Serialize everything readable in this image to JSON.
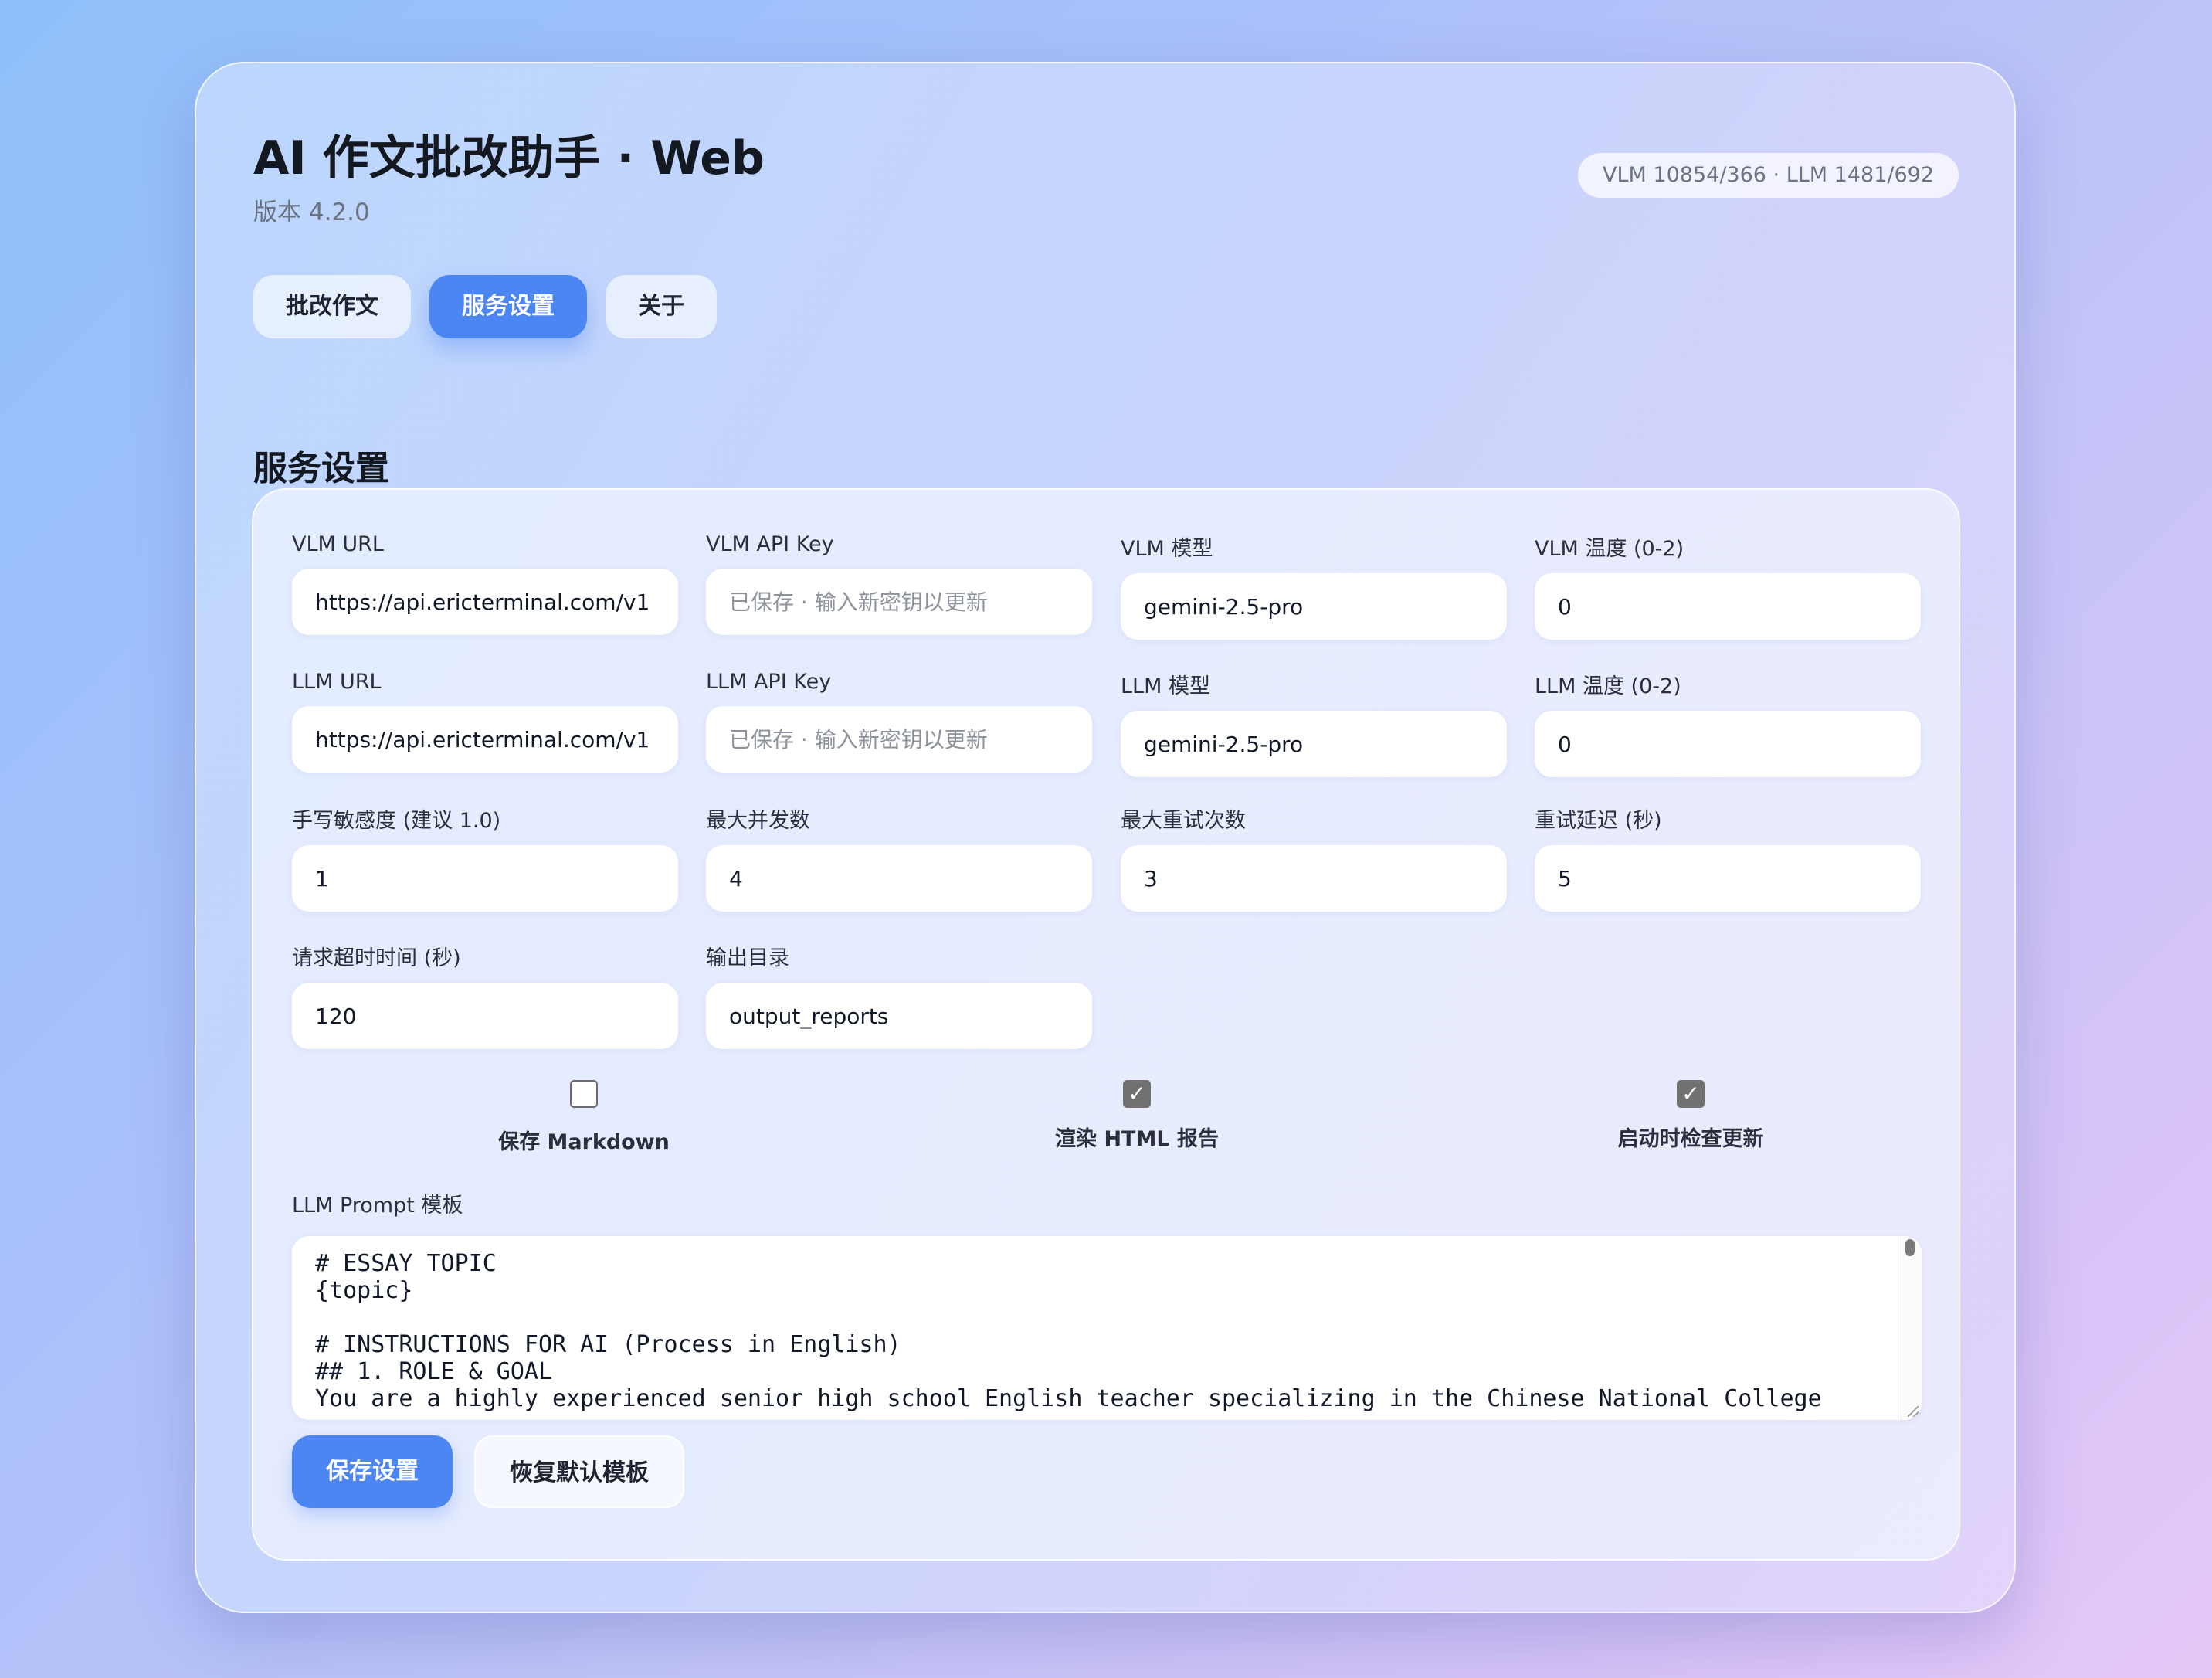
{
  "app": {
    "title": "AI 作文批改助手 · Web",
    "version": "版本 4.2.0",
    "usage_badge": "VLM 10854/366 · LLM 1481/692"
  },
  "tabs": [
    {
      "label": "批改作文",
      "active": false
    },
    {
      "label": "服务设置",
      "active": true
    },
    {
      "label": "关于",
      "active": false
    }
  ],
  "section_title": "服务设置",
  "fields": {
    "vlm_url": {
      "label": "VLM URL",
      "value": "https://api.ericterminal.com/v1"
    },
    "vlm_api_key": {
      "label": "VLM API Key",
      "value": "",
      "placeholder": "已保存 · 输入新密钥以更新"
    },
    "vlm_model": {
      "label": "VLM 模型",
      "value": "gemini-2.5-pro"
    },
    "vlm_temperature": {
      "label": "VLM 温度 (0-2)",
      "value": "0"
    },
    "llm_url": {
      "label": "LLM URL",
      "value": "https://api.ericterminal.com/v1"
    },
    "llm_api_key": {
      "label": "LLM API Key",
      "value": "",
      "placeholder": "已保存 · 输入新密钥以更新"
    },
    "llm_model": {
      "label": "LLM 模型",
      "value": "gemini-2.5-pro"
    },
    "llm_temperature": {
      "label": "LLM 温度 (0-2)",
      "value": "0"
    },
    "handwriting_sensitivity": {
      "label": "手写敏感度 (建议 1.0)",
      "value": "1"
    },
    "max_concurrency": {
      "label": "最大并发数",
      "value": "4"
    },
    "max_retries": {
      "label": "最大重试次数",
      "value": "3"
    },
    "retry_delay": {
      "label": "重试延迟 (秒)",
      "value": "5"
    },
    "request_timeout": {
      "label": "请求超时时间 (秒)",
      "value": "120"
    },
    "output_dir": {
      "label": "输出目录",
      "value": "output_reports"
    }
  },
  "checkboxes": [
    {
      "label": "保存 Markdown",
      "checked": false
    },
    {
      "label": "渲染 HTML 报告",
      "checked": true
    },
    {
      "label": "启动时检查更新",
      "checked": true
    }
  ],
  "prompt": {
    "label": "LLM Prompt 模板",
    "value": "# ESSAY TOPIC\n{topic}\n\n# INSTRUCTIONS FOR AI (Process in English)\n## 1. ROLE & GOAL\nYou are a highly experienced senior high school English teacher specializing in the Chinese National College"
  },
  "actions": {
    "save_label": "保存设置",
    "reset_label": "恢复默认模板"
  },
  "colors": {
    "accent": "#4c86f2",
    "checkbox_checked": "#717171"
  }
}
